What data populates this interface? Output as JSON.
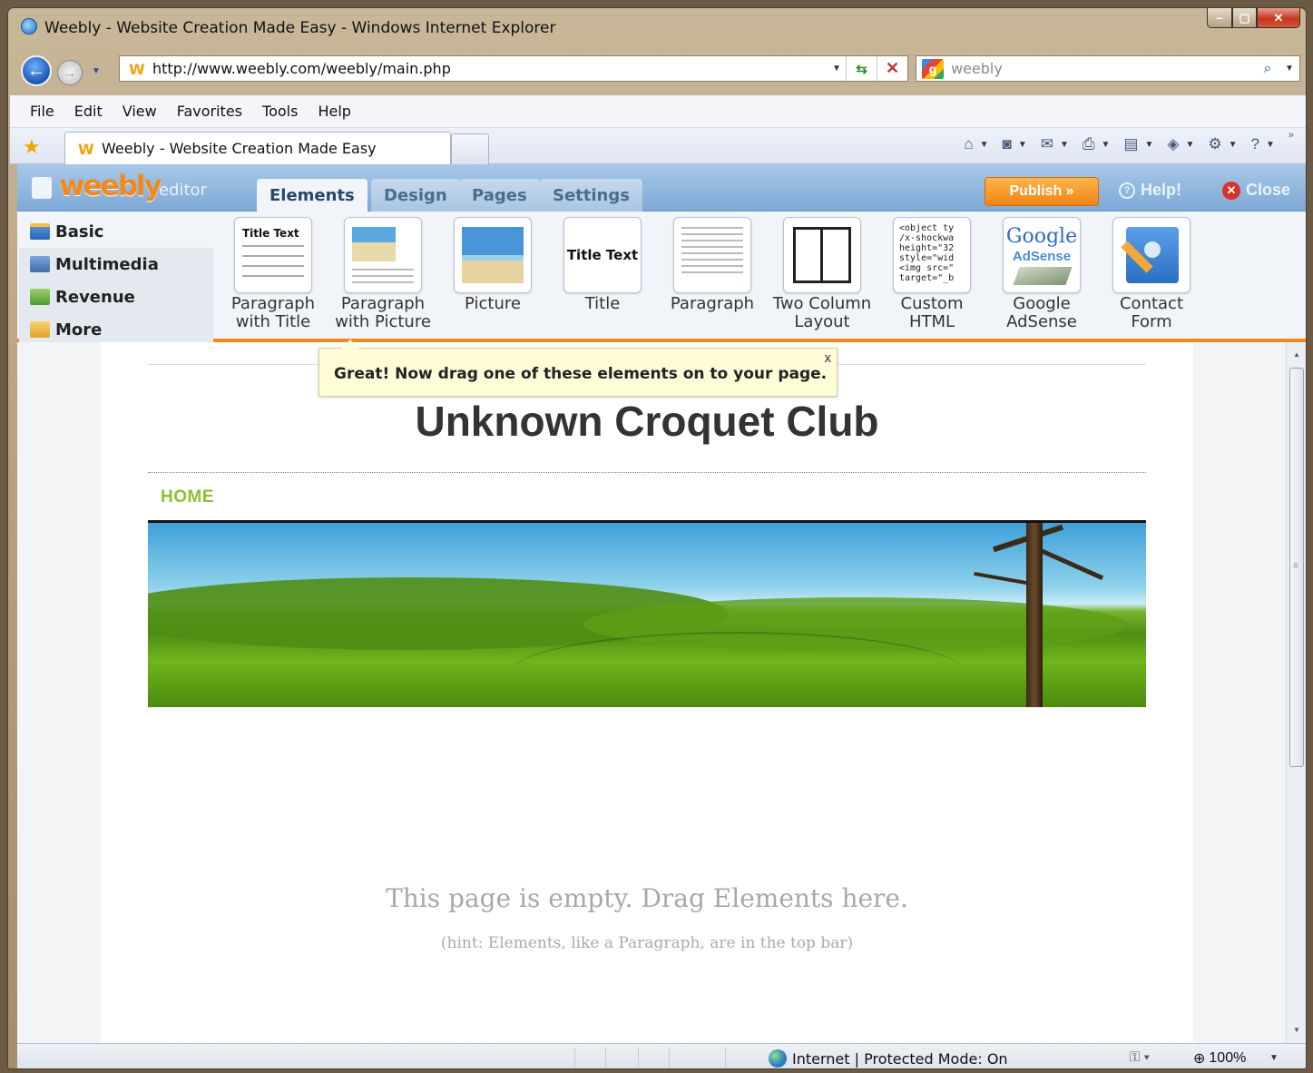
{
  "window": {
    "title": "Weebly - Website Creation Made Easy - Windows Internet Explorer",
    "btn_minimize": "–",
    "btn_maximize": "▢",
    "btn_close": "✕"
  },
  "address": {
    "url": "http://www.weebly.com/weebly/main.php",
    "search_placeholder": "weebly",
    "back_glyph": "←",
    "forward_glyph": "→"
  },
  "menu": [
    "File",
    "Edit",
    "View",
    "Favorites",
    "Tools",
    "Help"
  ],
  "tab": {
    "label": "Weebly - Website Creation Made Easy"
  },
  "editor": {
    "logo": "weebly",
    "logo_suffix": "editor",
    "tabs": [
      "Elements",
      "Design",
      "Pages",
      "Settings"
    ],
    "active_tab": "Elements",
    "publish": "Publish »",
    "help": "Help!",
    "close": "Close"
  },
  "categories": [
    "Basic",
    "Multimedia",
    "Revenue",
    "More"
  ],
  "elements": [
    {
      "line1": "Paragraph",
      "line2": "with Title",
      "icon": "paragraph-title-icon"
    },
    {
      "line1": "Paragraph",
      "line2": "with Picture",
      "icon": "paragraph-picture-icon"
    },
    {
      "line1": "Picture",
      "line2": "",
      "icon": "picture-icon"
    },
    {
      "line1": "Title",
      "line2": "",
      "icon": "title-icon"
    },
    {
      "line1": "Paragraph",
      "line2": "",
      "icon": "paragraph-icon"
    },
    {
      "line1": "Two Column",
      "line2": "Layout",
      "icon": "two-column-icon"
    },
    {
      "line1": "Custom",
      "line2": "HTML",
      "icon": "custom-html-icon"
    },
    {
      "line1": "Google",
      "line2": "AdSense",
      "icon": "adsense-icon"
    },
    {
      "line1": "Contact",
      "line2": "Form",
      "icon": "contact-form-icon"
    }
  ],
  "thumbs": {
    "title_text": "Title Text",
    "code_snippet": "<object ty\n/x-shockwa\nheight=\"32\nstyle=\"wid\n<img src=\"\ntarget=\"_b",
    "google": "Google",
    "adsense": "AdSense"
  },
  "tooltip": {
    "text": "Great! Now drag one of these elements on to your page.",
    "close": "x"
  },
  "page": {
    "site_title": "Unknown Croquet Club",
    "nav_home": "HOME",
    "empty_message": "This page is empty. Drag Elements here.",
    "empty_hint": "(hint: Elements, like a Paragraph, are in the top bar)"
  },
  "status": {
    "zone": "Internet | Protected Mode: On",
    "zoom": "100%"
  },
  "colors": {
    "weebly_orange": "#f08a1c",
    "home_green": "#8fbf32",
    "editor_blue": "#7ea9d6"
  }
}
